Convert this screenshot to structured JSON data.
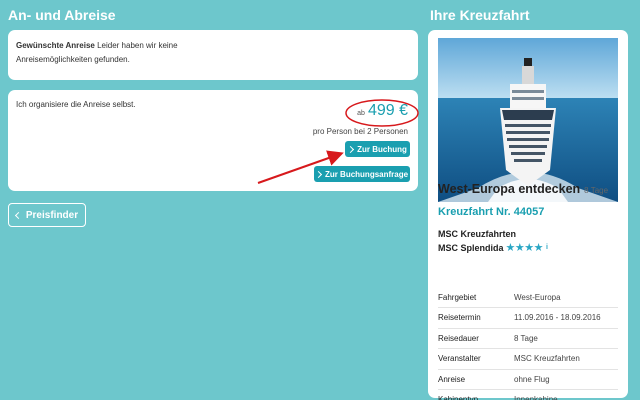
{
  "left": {
    "title": "An- und Abreise",
    "notice_bold": "Gewünschte Anreise",
    "notice_line1": "Leider haben wir keine",
    "notice_line2": "Anreisemöglichkeiten gefunden.",
    "option_text": "Ich organisiere die Anreise selbst.",
    "price_prefix": "ab",
    "price_value": "499 €",
    "price_note": "pro Person bei 2 Personen",
    "booking_button": "Zur Buchung",
    "request_button": "Zur Buchungsanfrage",
    "pricefinder_button": "Preisfinder"
  },
  "right": {
    "title": "Ihre Kreuzfahrt",
    "cruise_name": "West-Europa entdecken",
    "duration_short": "8 Tage",
    "cruise_number": "Kreuzfahrt Nr. 44057",
    "operator_line": "MSC Kreuzfahrten",
    "ship_line": "MSC Splendida",
    "stars": "★★★★",
    "info_icon": "i",
    "rating_stars": 4,
    "details": [
      {
        "label": "Fahrgebiet",
        "value": "West-Europa"
      },
      {
        "label": "Reisetermin",
        "value": "11.09.2016 - 18.09.2016"
      },
      {
        "label": "Reisedauer",
        "value": "8 Tage"
      },
      {
        "label": "Veranstalter",
        "value": "MSC Kreuzfahrten"
      },
      {
        "label": "Anreise",
        "value": "ohne Flug"
      },
      {
        "label": "Kabinentyp",
        "value": "Innenkabine"
      }
    ]
  },
  "colors": {
    "background": "#6dc7cc",
    "accent": "#1a9fb0",
    "highlight": "#d7191c",
    "star": "#2aa6c4"
  },
  "icons": [
    "chevron-right-icon",
    "chevron-left-icon",
    "info-icon",
    "star-icon",
    "red-arrow-annotation",
    "red-ellipse-annotation"
  ]
}
